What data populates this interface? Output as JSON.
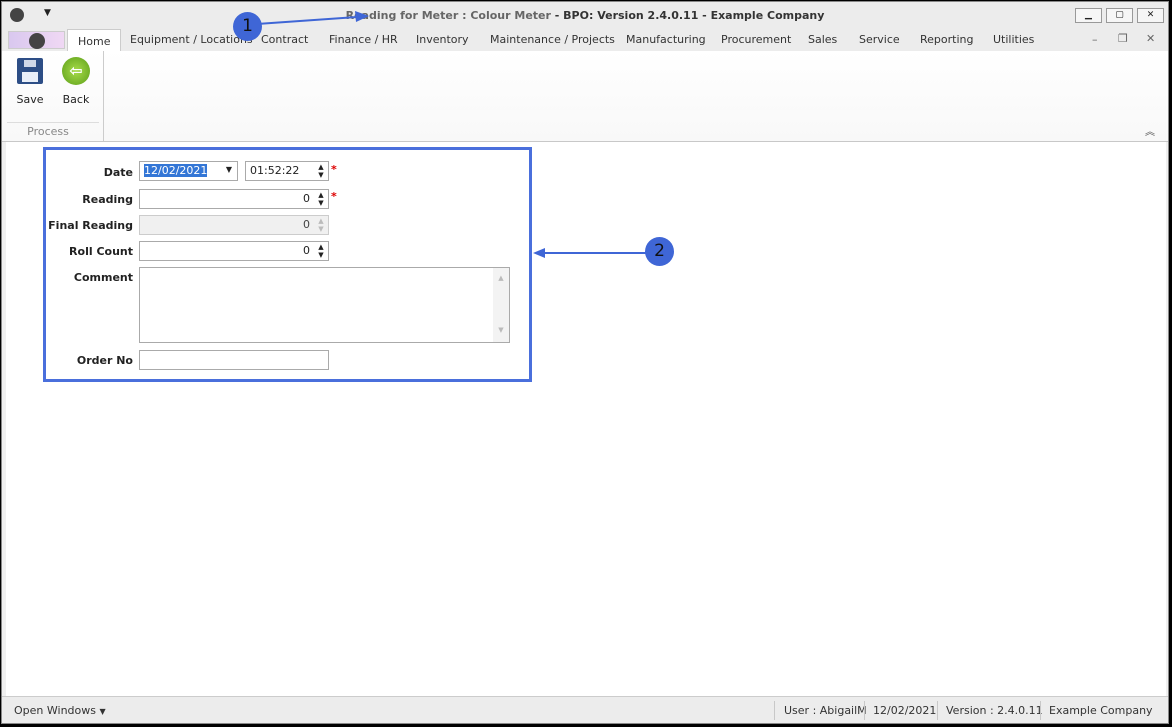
{
  "window": {
    "title_prefix": "Reading for Meter : Colour Meter",
    "title_main": " - BPO: Version 2.4.0.11 - Example Company",
    "minimize": "▁",
    "maximize": "▢",
    "close": "✕"
  },
  "tabs": [
    "Home",
    "Equipment / Locations",
    "Contract",
    "Finance / HR",
    "Inventory",
    "Maintenance / Projects",
    "Manufacturing",
    "Procurement",
    "Sales",
    "Service",
    "Reporting",
    "Utilities"
  ],
  "ribbon": {
    "save": "Save",
    "back": "Back",
    "group": "Process"
  },
  "form": {
    "date_label": "Date",
    "date_value": "12/02/2021",
    "time_value": "01:52:22",
    "reading_label": "Reading",
    "reading_value": "0",
    "final_reading_label": "Final Reading",
    "final_reading_value": "0",
    "roll_count_label": "Roll Count",
    "roll_count_value": "0",
    "comment_label": "Comment",
    "comment_value": "",
    "order_no_label": "Order No",
    "order_no_value": "",
    "required_mark": "*"
  },
  "callouts": [
    "1",
    "2"
  ],
  "status": {
    "open_windows": "Open Windows",
    "user": "User : AbigailM",
    "date": "12/02/2021",
    "version": "Version : 2.4.0.11",
    "company": "Example Company"
  },
  "colors": {
    "accent": "#3f66d6",
    "selection": "#3376d6",
    "required": "#dd0000"
  }
}
